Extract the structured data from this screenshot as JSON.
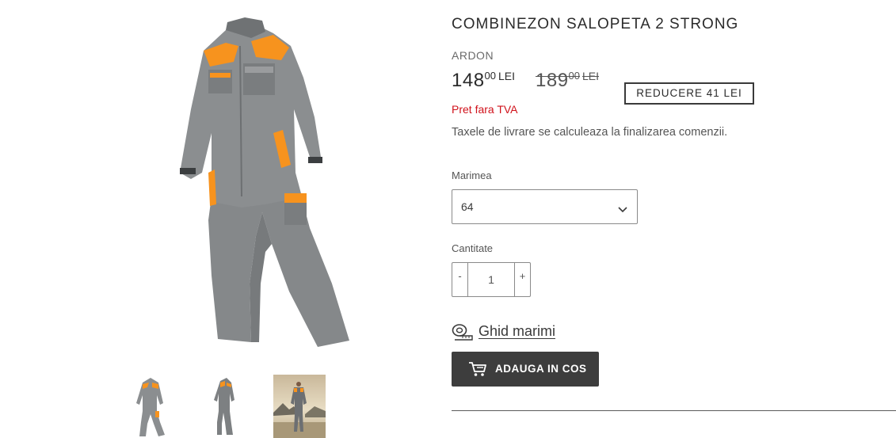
{
  "product": {
    "title": "COMBINEZON SALOPETA 2 STRONG",
    "vendor": "ARDON",
    "price": {
      "sale_main": "148",
      "sale_cents": "00",
      "sale_currency": "LEI",
      "compare_main": "189",
      "compare_cents": "00",
      "compare_currency": "LEI"
    },
    "discount_badge": "REDUCERE 41 LEI",
    "vat_note": "Pret fara TVA",
    "shipping_note": "Taxele de livrare se calculeaza la finalizarea comenzii."
  },
  "size": {
    "label": "Marimea",
    "selected": "64"
  },
  "quantity": {
    "label": "Cantitate",
    "minus": "-",
    "plus": "+",
    "value": "1"
  },
  "size_guide": {
    "label": "Ghid marimi",
    "icon": "tape-measure-icon"
  },
  "cart": {
    "button_label": "ADAUGA IN COS",
    "icon": "cart-icon"
  },
  "gallery": {
    "main_image": "coverall-image",
    "thumbnails": [
      "coverall-front-thumb",
      "coverall-side-thumb",
      "coverall-model-thumb"
    ]
  },
  "colors": {
    "accent_red": "#d0121b",
    "button_bg": "#3d3d3d",
    "coverall_grey": "#8b8e90",
    "coverall_orange": "#f7931e"
  }
}
